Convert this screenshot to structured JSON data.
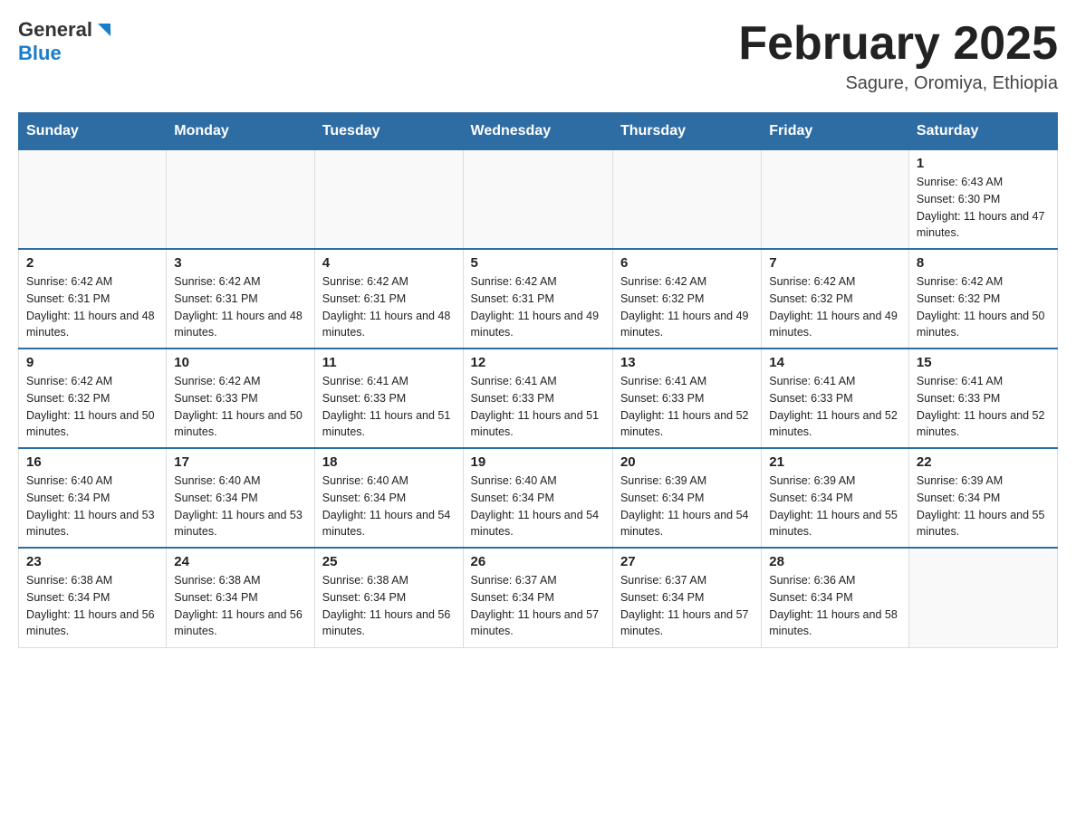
{
  "header": {
    "logo_general": "General",
    "logo_blue": "Blue",
    "month_title": "February 2025",
    "location": "Sagure, Oromiya, Ethiopia"
  },
  "calendar": {
    "days_of_week": [
      "Sunday",
      "Monday",
      "Tuesday",
      "Wednesday",
      "Thursday",
      "Friday",
      "Saturday"
    ],
    "weeks": [
      [
        {
          "day": "",
          "info": ""
        },
        {
          "day": "",
          "info": ""
        },
        {
          "day": "",
          "info": ""
        },
        {
          "day": "",
          "info": ""
        },
        {
          "day": "",
          "info": ""
        },
        {
          "day": "",
          "info": ""
        },
        {
          "day": "1",
          "info": "Sunrise: 6:43 AM\nSunset: 6:30 PM\nDaylight: 11 hours and 47 minutes."
        }
      ],
      [
        {
          "day": "2",
          "info": "Sunrise: 6:42 AM\nSunset: 6:31 PM\nDaylight: 11 hours and 48 minutes."
        },
        {
          "day": "3",
          "info": "Sunrise: 6:42 AM\nSunset: 6:31 PM\nDaylight: 11 hours and 48 minutes."
        },
        {
          "day": "4",
          "info": "Sunrise: 6:42 AM\nSunset: 6:31 PM\nDaylight: 11 hours and 48 minutes."
        },
        {
          "day": "5",
          "info": "Sunrise: 6:42 AM\nSunset: 6:31 PM\nDaylight: 11 hours and 49 minutes."
        },
        {
          "day": "6",
          "info": "Sunrise: 6:42 AM\nSunset: 6:32 PM\nDaylight: 11 hours and 49 minutes."
        },
        {
          "day": "7",
          "info": "Sunrise: 6:42 AM\nSunset: 6:32 PM\nDaylight: 11 hours and 49 minutes."
        },
        {
          "day": "8",
          "info": "Sunrise: 6:42 AM\nSunset: 6:32 PM\nDaylight: 11 hours and 50 minutes."
        }
      ],
      [
        {
          "day": "9",
          "info": "Sunrise: 6:42 AM\nSunset: 6:32 PM\nDaylight: 11 hours and 50 minutes."
        },
        {
          "day": "10",
          "info": "Sunrise: 6:42 AM\nSunset: 6:33 PM\nDaylight: 11 hours and 50 minutes."
        },
        {
          "day": "11",
          "info": "Sunrise: 6:41 AM\nSunset: 6:33 PM\nDaylight: 11 hours and 51 minutes."
        },
        {
          "day": "12",
          "info": "Sunrise: 6:41 AM\nSunset: 6:33 PM\nDaylight: 11 hours and 51 minutes."
        },
        {
          "day": "13",
          "info": "Sunrise: 6:41 AM\nSunset: 6:33 PM\nDaylight: 11 hours and 52 minutes."
        },
        {
          "day": "14",
          "info": "Sunrise: 6:41 AM\nSunset: 6:33 PM\nDaylight: 11 hours and 52 minutes."
        },
        {
          "day": "15",
          "info": "Sunrise: 6:41 AM\nSunset: 6:33 PM\nDaylight: 11 hours and 52 minutes."
        }
      ],
      [
        {
          "day": "16",
          "info": "Sunrise: 6:40 AM\nSunset: 6:34 PM\nDaylight: 11 hours and 53 minutes."
        },
        {
          "day": "17",
          "info": "Sunrise: 6:40 AM\nSunset: 6:34 PM\nDaylight: 11 hours and 53 minutes."
        },
        {
          "day": "18",
          "info": "Sunrise: 6:40 AM\nSunset: 6:34 PM\nDaylight: 11 hours and 54 minutes."
        },
        {
          "day": "19",
          "info": "Sunrise: 6:40 AM\nSunset: 6:34 PM\nDaylight: 11 hours and 54 minutes."
        },
        {
          "day": "20",
          "info": "Sunrise: 6:39 AM\nSunset: 6:34 PM\nDaylight: 11 hours and 54 minutes."
        },
        {
          "day": "21",
          "info": "Sunrise: 6:39 AM\nSunset: 6:34 PM\nDaylight: 11 hours and 55 minutes."
        },
        {
          "day": "22",
          "info": "Sunrise: 6:39 AM\nSunset: 6:34 PM\nDaylight: 11 hours and 55 minutes."
        }
      ],
      [
        {
          "day": "23",
          "info": "Sunrise: 6:38 AM\nSunset: 6:34 PM\nDaylight: 11 hours and 56 minutes."
        },
        {
          "day": "24",
          "info": "Sunrise: 6:38 AM\nSunset: 6:34 PM\nDaylight: 11 hours and 56 minutes."
        },
        {
          "day": "25",
          "info": "Sunrise: 6:38 AM\nSunset: 6:34 PM\nDaylight: 11 hours and 56 minutes."
        },
        {
          "day": "26",
          "info": "Sunrise: 6:37 AM\nSunset: 6:34 PM\nDaylight: 11 hours and 57 minutes."
        },
        {
          "day": "27",
          "info": "Sunrise: 6:37 AM\nSunset: 6:34 PM\nDaylight: 11 hours and 57 minutes."
        },
        {
          "day": "28",
          "info": "Sunrise: 6:36 AM\nSunset: 6:34 PM\nDaylight: 11 hours and 58 minutes."
        },
        {
          "day": "",
          "info": ""
        }
      ]
    ]
  }
}
